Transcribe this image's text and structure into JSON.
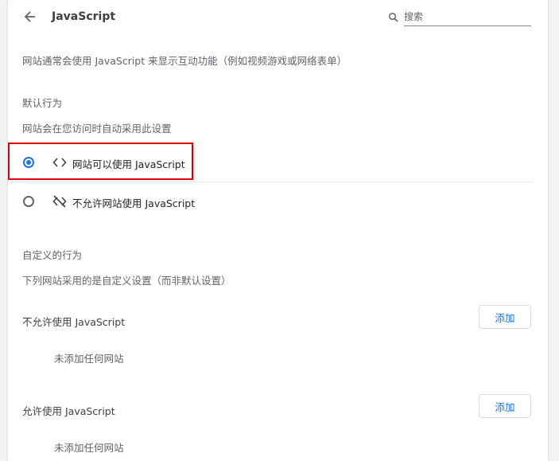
{
  "header": {
    "title": "JavaScript",
    "search_placeholder": "搜索"
  },
  "description": "网站通常会使用 JavaScript 来显示互动功能（例如视频游戏或网络表单）",
  "default_behavior": {
    "heading": "默认行为",
    "subheading": "网站会在您访问时自动采用此设置",
    "options": [
      {
        "label": "网站可以使用 JavaScript",
        "icon": "code-icon",
        "checked": true
      },
      {
        "label": "不允许网站使用 JavaScript",
        "icon": "code-off-icon",
        "checked": false
      }
    ]
  },
  "custom_behavior": {
    "heading": "自定义的行为",
    "subheading": "下列网站采用的是自定义设置（而非默认设置）",
    "lists": [
      {
        "title": "不允许使用 JavaScript",
        "add_label": "添加",
        "empty_text": "未添加任何网站"
      },
      {
        "title": "允许使用 JavaScript",
        "add_label": "添加",
        "empty_text": "未添加任何网站"
      }
    ]
  },
  "colors": {
    "accent": "#1a73e8",
    "highlight_border": "#e00000"
  }
}
